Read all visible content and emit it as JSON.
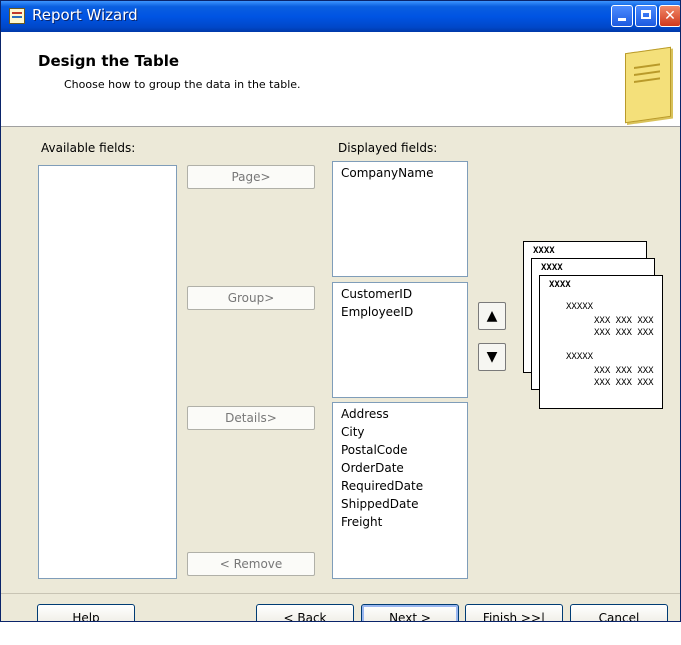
{
  "window": {
    "title": "Report Wizard"
  },
  "header": {
    "title": "Design the Table",
    "subtitle": "Choose how to group the data in the table."
  },
  "available_fields": {
    "label": "Available fields:",
    "items": []
  },
  "displayed_fields": {
    "label": "Displayed fields:",
    "page_items": [
      "CompanyName"
    ],
    "group_items": [
      "CustomerID",
      "EmployeeID"
    ],
    "details_items": [
      "Address",
      "City",
      "PostalCode",
      "OrderDate",
      "RequiredDate",
      "ShippedDate",
      "Freight"
    ]
  },
  "move_buttons": {
    "page": "Page>",
    "group": "Group>",
    "details": "Details>",
    "remove": "< Remove"
  },
  "preview": {
    "header_placeholder": "XXXX",
    "group_placeholder": "XXXXX",
    "row_placeholder": "XXX XXX XXX"
  },
  "footer": {
    "help": "Help",
    "back": "< Back",
    "next": "Next >",
    "finish": "Finish >>|",
    "cancel": "Cancel"
  }
}
